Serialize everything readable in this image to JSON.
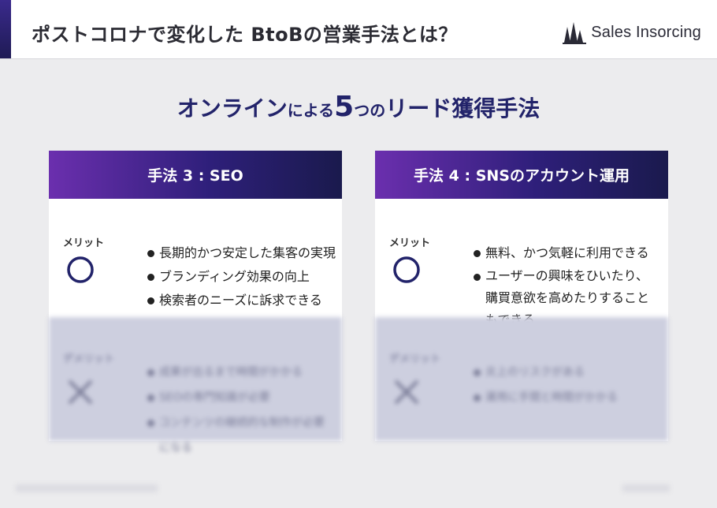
{
  "header": {
    "title": "ポストコロナで変化した BtoBの営業手法とは？",
    "logo_text": "Sales Insorcing",
    "logo_icon": "building-bars-icon"
  },
  "slide": {
    "title_parts": [
      "オンライン",
      "による",
      "5",
      "つの",
      "リード獲得手法"
    ]
  },
  "cards": [
    {
      "heading": "手法 3 : SEO",
      "merit": {
        "label": "メリット",
        "icon": "circle-icon",
        "points": [
          "長期的かつ安定した集客の実現",
          "ブランディング効果の向上",
          "検索者のニーズに訴求できる"
        ]
      },
      "demerit": {
        "label": "デメリット",
        "icon": "cross-icon",
        "points": [
          "成果が出るまで時間がかかる",
          "SEOの専門知識が必要",
          "コンテンツの継続的な制作が必要になる"
        ]
      }
    },
    {
      "heading": "手法 4 : SNSのアカウント運用",
      "merit": {
        "label": "メリット",
        "icon": "circle-icon",
        "points": [
          "無料、かつ気軽に利用できる",
          "ユーザーの興味をひいたり、購買意欲を高めたりすることもできる"
        ]
      },
      "demerit": {
        "label": "デメリット",
        "icon": "cross-icon",
        "points": [
          "炎上のリスクがある",
          "運用に手間と時間がかかる"
        ]
      }
    }
  ],
  "colors": {
    "accent_dark": "#22236a",
    "gradient_start": "#6b2fae",
    "gradient_end": "#1a1a4d",
    "demerit_bg": "#cdcfdf"
  }
}
